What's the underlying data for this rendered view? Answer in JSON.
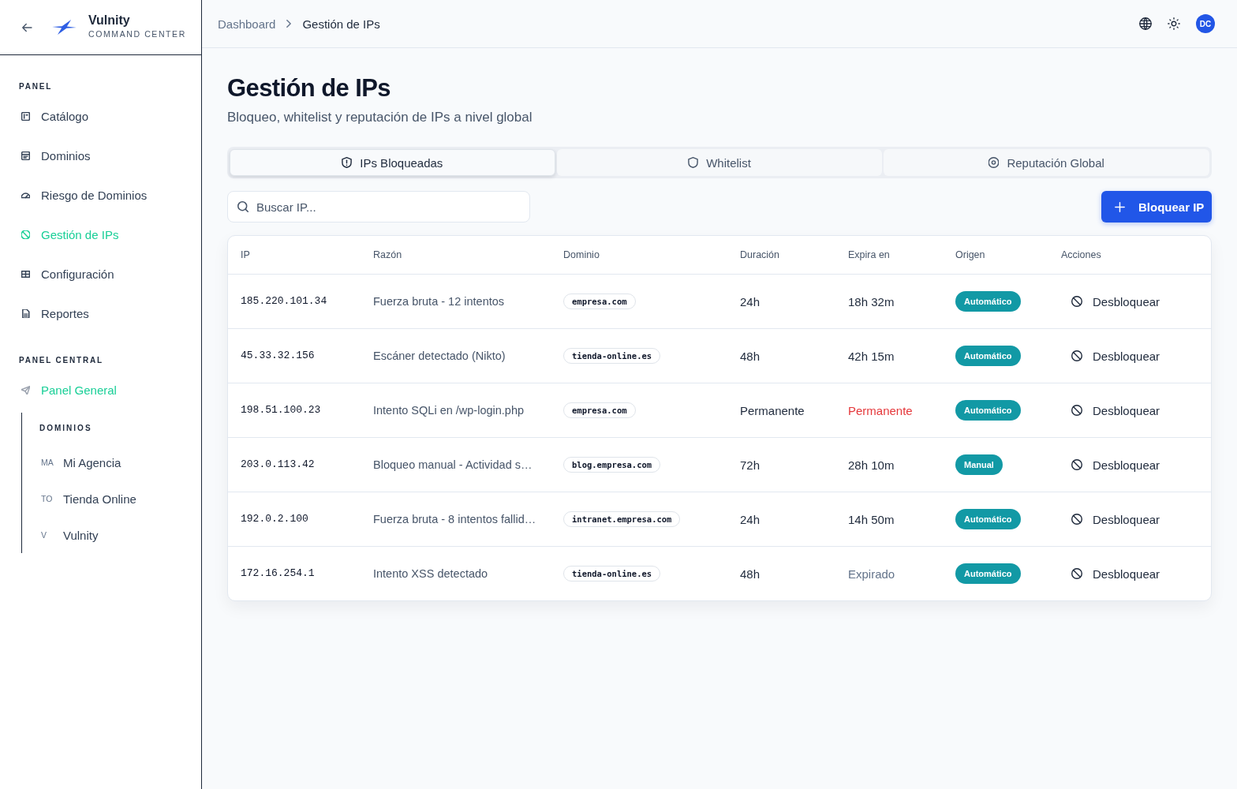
{
  "sidebar": {
    "brand": {
      "name": "Vulnity",
      "tagline": "COMMAND CENTER"
    },
    "panel": {
      "title": "PANEL",
      "items": [
        {
          "label": "Catálogo",
          "selected": false
        },
        {
          "label": "Dominios",
          "selected": false
        },
        {
          "label": "Riesgo de Dominios",
          "selected": false
        },
        {
          "label": "Gestión de IPs",
          "selected": true
        },
        {
          "label": "Configuración",
          "selected": false
        },
        {
          "label": "Reportes",
          "selected": false
        }
      ]
    },
    "central": {
      "title": "PANEL CENTRAL",
      "items": [
        {
          "label": "Panel General",
          "selected": true
        }
      ],
      "group": {
        "title": "DOMINIOS",
        "items": [
          {
            "initials": "MA",
            "label": "Mi Agencia",
            "selected": false
          },
          {
            "initials": "TO",
            "label": "Tienda Online",
            "selected": false
          },
          {
            "initials": "V",
            "label": "Vulnity",
            "selected": false
          }
        ]
      }
    }
  },
  "topbar": {
    "breadcrumb": [
      "Dashboard",
      "Gestión de IPs"
    ],
    "avatar": "DC"
  },
  "page": {
    "title": "Gestión de IPs",
    "subtitle": "Bloqueo, whitelist y reputación de IPs a nivel global"
  },
  "tabs": [
    {
      "label": "IPs Bloqueadas",
      "selected": true
    },
    {
      "label": "Whitelist",
      "selected": false
    },
    {
      "label": "Reputación Global",
      "selected": false
    }
  ],
  "search": {
    "placeholder": "Buscar IP..."
  },
  "block_button": "Bloquear IP",
  "table": {
    "columns": [
      "IP",
      "Razón",
      "Dominio",
      "Duración",
      "Expira en",
      "Origen",
      "Acciones"
    ],
    "rows": [
      {
        "ip": "185.220.101.34",
        "reason": "Fuerza bruta - 12 intentos",
        "domain": "empresa.com",
        "duration": "24h",
        "expires": "18h 32m",
        "permanent": false,
        "expired": false,
        "origin": "Automático",
        "action": "Desbloquear"
      },
      {
        "ip": "45.33.32.156",
        "reason": "Escáner detectado (Nikto)",
        "domain": "tienda-online.es",
        "duration": "48h",
        "expires": "42h 15m",
        "permanent": false,
        "expired": false,
        "origin": "Automático",
        "action": "Desbloquear"
      },
      {
        "ip": "198.51.100.23",
        "reason": "Intento SQLi en /wp-login.php",
        "domain": "empresa.com",
        "duration": "Permanente",
        "expires": "Permanente",
        "permanent": true,
        "expired": false,
        "origin": "Automático",
        "action": "Desbloquear"
      },
      {
        "ip": "203.0.113.42",
        "reason": "Bloqueo manual - Actividad s…",
        "domain": "blog.empresa.com",
        "duration": "72h",
        "expires": "28h 10m",
        "permanent": false,
        "expired": false,
        "origin": "Manual",
        "action": "Desbloquear"
      },
      {
        "ip": "192.0.2.100",
        "reason": "Fuerza bruta - 8 intentos fallid…",
        "domain": "intranet.empresa.com",
        "duration": "24h",
        "expires": "14h 50m",
        "permanent": false,
        "expired": false,
        "origin": "Automático",
        "action": "Desbloquear"
      },
      {
        "ip": "172.16.254.1",
        "reason": "Intento XSS detectado",
        "domain": "tienda-online.es",
        "duration": "48h",
        "expires": "Expirado",
        "permanent": false,
        "expired": true,
        "origin": "Automático",
        "action": "Desbloquear"
      }
    ]
  }
}
